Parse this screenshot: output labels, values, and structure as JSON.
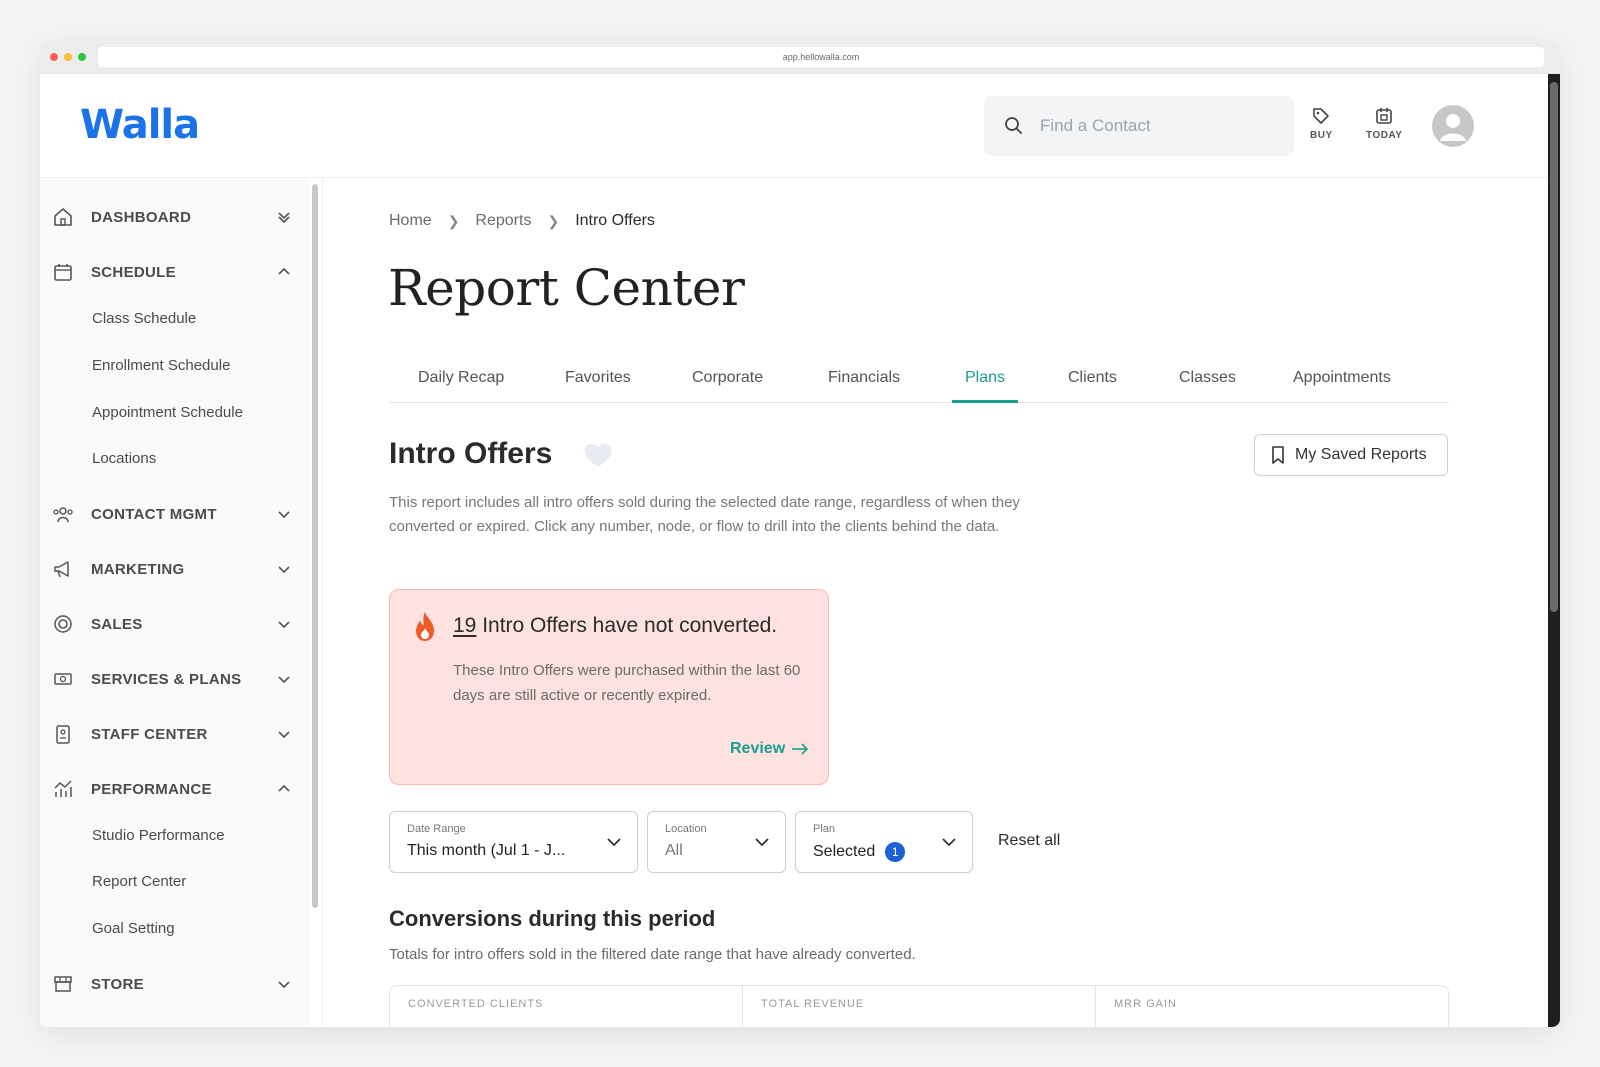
{
  "browser": {
    "url": "app.hellowalla.com"
  },
  "header": {
    "logo": "Walla",
    "search_placeholder": "Find a Contact",
    "buy_label": "BUY",
    "today_label": "TODAY"
  },
  "sidebar": {
    "dashboard": "DASHBOARD",
    "schedule": "SCHEDULE",
    "schedule_items": [
      "Class Schedule",
      "Enrollment Schedule",
      "Appointment Schedule",
      "Locations"
    ],
    "contact_mgmt": "CONTACT MGMT",
    "marketing": "MARKETING",
    "sales": "SALES",
    "services_plans": "SERVICES & PLANS",
    "staff_center": "STAFF CENTER",
    "performance": "PERFORMANCE",
    "performance_items": [
      "Studio Performance",
      "Report Center",
      "Goal Setting"
    ],
    "store": "STORE"
  },
  "breadcrumb": [
    "Home",
    "Reports",
    "Intro Offers"
  ],
  "page_title": "Report Center",
  "tabs": [
    "Daily Recap",
    "Favorites",
    "Corporate",
    "Financials",
    "Plans",
    "Clients",
    "Classes",
    "Appointments"
  ],
  "active_tab": "Plans",
  "section": {
    "title": "Intro Offers",
    "saved_reports": "My Saved Reports",
    "description": "This report includes all intro offers sold during the selected date range, regardless of when they converted or expired. Click any number, node, or flow to drill into the clients behind the data."
  },
  "alert": {
    "count": "19",
    "title": " Intro Offers have not converted.",
    "text": "These Intro Offers were purchased within the last 60 days are still active or recently expired.",
    "action": "Review"
  },
  "filters": {
    "date_range_label": "Date Range",
    "date_range_value": "This month (Jul 1 - J...",
    "location_label": "Location",
    "location_value": "All",
    "plan_label": "Plan",
    "plan_value": "Selected",
    "plan_count": "1",
    "reset": "Reset all"
  },
  "conversions": {
    "title": "Conversions during this period",
    "subtitle": "Totals for intro offers sold in the filtered date range that have already converted.",
    "columns": [
      "CONVERTED CLIENTS",
      "TOTAL REVENUE",
      "MRR GAIN"
    ]
  },
  "colors": {
    "brand": "#1a73e8",
    "accent": "#1a9e8f",
    "alert_bg": "#fde2df",
    "flame": "#f05a28"
  }
}
